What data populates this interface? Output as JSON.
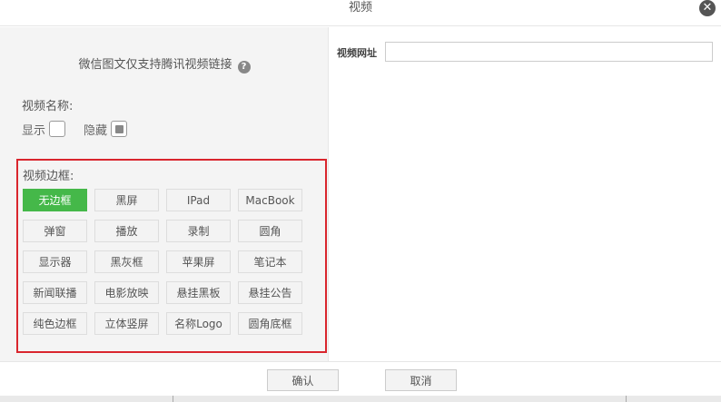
{
  "dialog": {
    "title": "视频",
    "close_icon": "close-icon"
  },
  "left": {
    "notice": "微信图文仅支持腾讯视频链接",
    "help_icon": "?",
    "name_label": "视频名称:",
    "show_label": "显示",
    "hide_label": "隐藏",
    "show_checked": false,
    "hide_checked": true,
    "border_label": "视频边框:",
    "styles": [
      {
        "label": "无边框",
        "active": true
      },
      {
        "label": "黑屏"
      },
      {
        "label": "IPad"
      },
      {
        "label": "MacBook"
      },
      {
        "label": "弹窗"
      },
      {
        "label": "播放"
      },
      {
        "label": "录制"
      },
      {
        "label": "圆角"
      },
      {
        "label": "显示器"
      },
      {
        "label": "黑灰框"
      },
      {
        "label": "苹果屏"
      },
      {
        "label": "笔记本"
      },
      {
        "label": "新闻联播"
      },
      {
        "label": "电影放映"
      },
      {
        "label": "悬挂黑板"
      },
      {
        "label": "悬挂公告"
      },
      {
        "label": "纯色边框"
      },
      {
        "label": "立体竖屏"
      },
      {
        "label": "名称Logo"
      },
      {
        "label": "圆角底框"
      }
    ]
  },
  "right": {
    "url_label": "视频网址",
    "url_value": ""
  },
  "footer": {
    "ok_label": "确认",
    "cancel_label": "取消"
  },
  "colors": {
    "active_green": "#45b849",
    "highlight_red": "#d9252d"
  }
}
